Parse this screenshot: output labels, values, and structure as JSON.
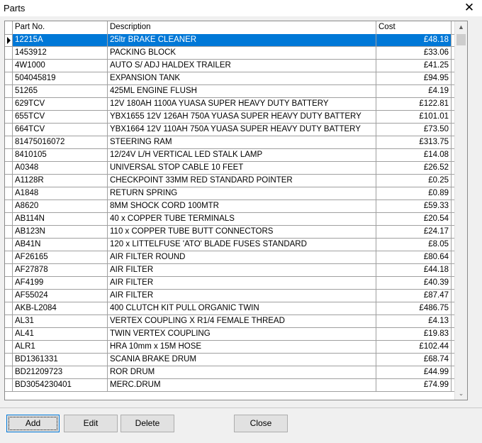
{
  "window": {
    "title": "Parts",
    "close_glyph": "✕"
  },
  "table": {
    "columns": [
      "Part No.",
      "Description",
      "Cost"
    ],
    "rows": [
      [
        "12215A",
        "25ltr BRAKE CLEANER",
        "£48.18"
      ],
      [
        "1453912",
        "PACKING BLOCK",
        "£33.06"
      ],
      [
        "4W1000",
        "AUTO S/ ADJ HALDEX TRAILER",
        "£41.25"
      ],
      [
        "504045819",
        "EXPANSION TANK",
        "£94.95"
      ],
      [
        "51265",
        "425ML ENGINE FLUSH",
        "£4.19"
      ],
      [
        "629TCV",
        "12V 180AH 1100A YUASA SUPER HEAVY DUTY BATTERY",
        "£122.81"
      ],
      [
        "655TCV",
        "YBX1655 12V 126AH 750A YUASA SUPER HEAVY DUTY BATTERY",
        "£101.01"
      ],
      [
        "664TCV",
        "YBX1664 12V 110AH 750A YUASA SUPER HEAVY DUTY BATTERY",
        "£73.50"
      ],
      [
        "81475016072",
        "STEERING RAM",
        "£313.75"
      ],
      [
        "8410105",
        "12/24V L/H VERTICAL LED STALK LAMP",
        "£14.08"
      ],
      [
        "A0348",
        "UNIVERSAL STOP CABLE 10 FEET",
        "£26.52"
      ],
      [
        "A1128R",
        "CHECKPOINT 33MM RED STANDARD POINTER",
        "£0.25"
      ],
      [
        "A1848",
        "RETURN SPRING",
        "£0.89"
      ],
      [
        "A8620",
        "8MM SHOCK CORD 100MTR",
        "£59.33"
      ],
      [
        "AB114N",
        "40 x COPPER TUBE TERMINALS",
        "£20.54"
      ],
      [
        "AB123N",
        "110 x COPPER TUBE BUTT CONNECTORS",
        "£24.17"
      ],
      [
        "AB41N",
        "120 x LITTELFUSE 'ATO' BLADE FUSES STANDARD",
        "£8.05"
      ],
      [
        "AF26165",
        "AIR FILTER ROUND",
        "£80.64"
      ],
      [
        "AF27878",
        "AIR FILTER",
        "£44.18"
      ],
      [
        "AF4199",
        "AIR FILTER",
        "£40.39"
      ],
      [
        "AF55024",
        "AIR FILTER",
        "£87.47"
      ],
      [
        "AKB-L2084",
        "400 CLUTCH KIT PULL ORGANIC TWIN",
        "£486.75"
      ],
      [
        "AL31",
        "VERTEX COUPLING X R1/4 FEMALE THREAD",
        "£4.13"
      ],
      [
        "AL41",
        "TWIN VERTEX COUPLING",
        "£19.83"
      ],
      [
        "ALR1",
        "HRA 10mm x 15M HOSE",
        "£102.44"
      ],
      [
        "BD1361331",
        "SCANIA BRAKE DRUM",
        "£68.74"
      ],
      [
        "BD21209723",
        "ROR DRUM",
        "£44.99"
      ],
      [
        "BD3054230401",
        "MERC.DRUM",
        "£74.99"
      ]
    ],
    "selected_index": 0
  },
  "buttons": {
    "add": "Add",
    "edit": "Edit",
    "delete": "Delete",
    "close": "Close"
  },
  "colors": {
    "selection": "#0078d7",
    "default_button_border": "#0078d7"
  }
}
